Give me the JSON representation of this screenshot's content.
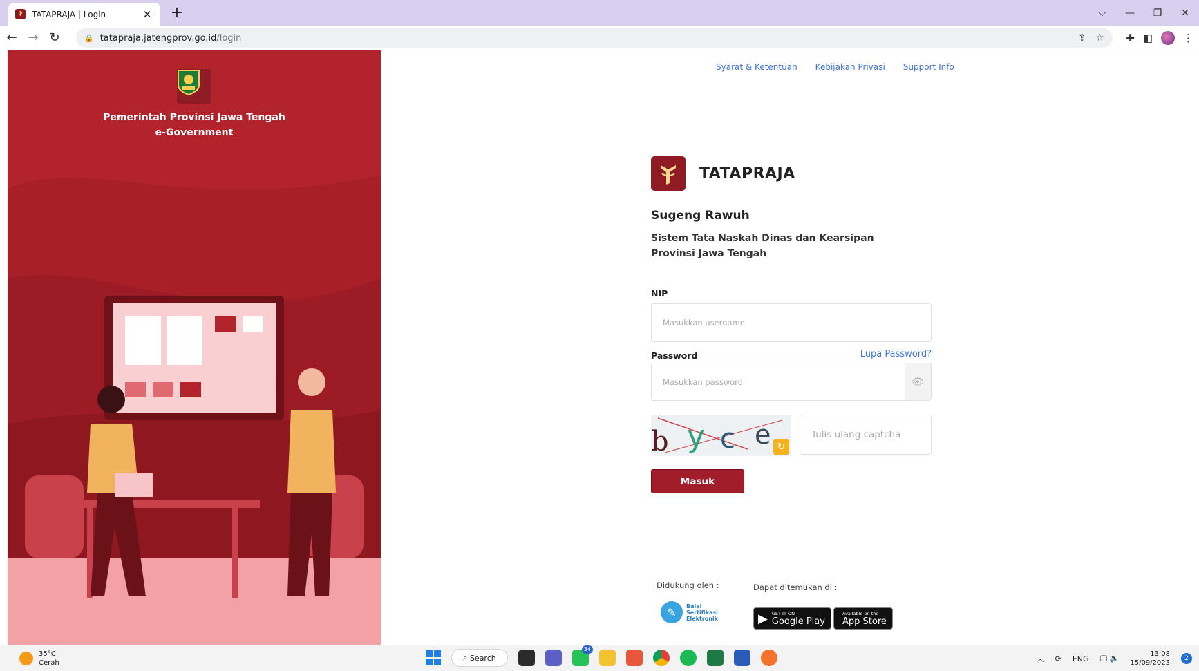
{
  "browser": {
    "tab_title": "TATAPRAJA | Login",
    "tab_close": "✕",
    "new_tab": "+",
    "url_host": "tatapraja.jatengprov.go.id",
    "url_path": "/login",
    "window_controls": {
      "chevron": "⌵",
      "minimize": "—",
      "restore": "❐",
      "close": "✕"
    }
  },
  "left": {
    "org_name": "Pemerintah Provinsi Jawa Tengah",
    "org_sub": "e-Government"
  },
  "links": {
    "terms": "Syarat & Ketentuan",
    "privacy": "Kebijakan Privasi",
    "support": "Support Info"
  },
  "brand": {
    "name": "TATAPRAJA"
  },
  "welcome": "Sugeng Rawuh",
  "subtitle_line1": "Sistem Tata Naskah Dinas dan Kearsipan",
  "subtitle_line2": "Provinsi Jawa Tengah",
  "form": {
    "nip_label": "NIP",
    "nip_placeholder": "Masukkan username",
    "password_label": "Password",
    "forgot": "Lupa Password?",
    "password_placeholder": "Masukkan password",
    "captcha_text": "byce",
    "captcha_placeholder": "Tulis ulang captcha",
    "submit": "Masuk"
  },
  "footer": {
    "supported_by": "Didukung oleh :",
    "available_at": "Dapat ditemukan di :",
    "bsre_line1": "Balai",
    "bsre_line2": "Sertifikasi",
    "bsre_line3": "Elektronik",
    "google_small": "GET IT ON",
    "google_big": "Google Play",
    "apple_small": "Available on the",
    "apple_big": "App Store"
  },
  "taskbar": {
    "temperature": "35°C",
    "weather": "Cerah",
    "search": "Search",
    "whatsapp_badge": "34",
    "language": "ENG",
    "time": "13:08",
    "date": "15/09/2023",
    "notifications": "2"
  },
  "colors": {
    "left_panel": "#b3232c",
    "accent_button": "#a11d2a",
    "link_blue": "#3f76d8"
  }
}
